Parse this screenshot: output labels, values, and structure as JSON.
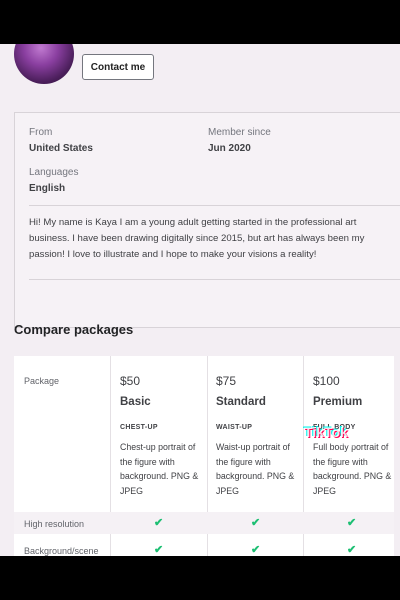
{
  "profile": {
    "contact_label": "Contact me",
    "from_label": "From",
    "from_value": "United States",
    "member_since_label": "Member since",
    "member_since_value": "Jun 2020",
    "languages_label": "Languages",
    "languages_value": "English",
    "bio": "Hi! My name is Kaya I am a young adult getting started in the professional art business. I have been drawing digitally since 2015, but art has always been my passion! I love to illustrate and I hope to make your visions a reality!"
  },
  "packages": {
    "title": "Compare packages",
    "row_package_label": "Package",
    "row_high_res_label": "High resolution",
    "row_background_label": "Background/scene",
    "tiers": [
      {
        "price": "$50",
        "name": "Basic",
        "subtitle": "CHEST-UP",
        "description": "Chest-up portrait of the figure with background. PNG & JPEG",
        "high_res": true,
        "background": true
      },
      {
        "price": "$75",
        "name": "Standard",
        "subtitle": "WAIST-UP",
        "description": "Waist-up portrait of the figure with background. PNG & JPEG",
        "high_res": true,
        "background": true
      },
      {
        "price": "$100",
        "name": "Premium",
        "subtitle": "FULL BODY",
        "description": "Full body portrait of the figure with background. PNG & JPEG",
        "high_res": true,
        "background": true
      }
    ],
    "check_glyph": "✔"
  },
  "watermark": {
    "brand": "TikTok",
    "handle": "@kaya"
  },
  "colors": {
    "check": "#1dbf73",
    "page_bg": "#f3eef3"
  }
}
